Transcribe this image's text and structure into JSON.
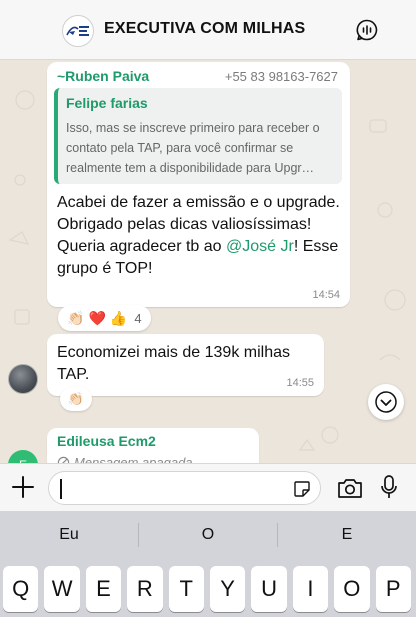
{
  "header": {
    "title": "EXECUTIVA COM MILHAS",
    "avatar_icon": "group-logo-icon",
    "call_icon": "group-call-icon"
  },
  "messages": [
    {
      "sender": "~Ruben Paiva",
      "phone": "+55 83 98163-7627",
      "quote": {
        "sender": "Felipe farias",
        "text": "Isso, mas se inscreve primeiro para receber o contato pela TAP, para você confirmar se realmente tem a disponibilidade para Upgr…"
      },
      "text_before": "Acabei de fazer a emissão e o upgrade. Obrigado pelas dicas valiosíssimas! Queria agradecer tb ao ",
      "mention": "@José Jr",
      "text_after": "! Esse grupo é TOP!",
      "time": "14:54",
      "reactions": [
        "👏🏻",
        "❤️",
        "👍"
      ],
      "reaction_count": "4"
    },
    {
      "text": "Economizei mais de 139k milhas TAP.",
      "time": "14:55",
      "reactions": [
        "👏🏻"
      ]
    },
    {
      "sender": "Edileusa Ecm2",
      "deleted_text": "Mensagem apagada",
      "avatar_initial": "E"
    }
  ],
  "input": {
    "placeholder": "",
    "value": ""
  },
  "keyboard": {
    "suggestions": [
      "Eu",
      "O",
      "E"
    ],
    "row1": [
      "Q",
      "W",
      "E",
      "R",
      "T",
      "Y",
      "U",
      "I",
      "O",
      "P"
    ]
  },
  "colors": {
    "accent": "#1f9a6a",
    "chat_bg": "#ece5dc",
    "bubble": "#ffffff"
  }
}
